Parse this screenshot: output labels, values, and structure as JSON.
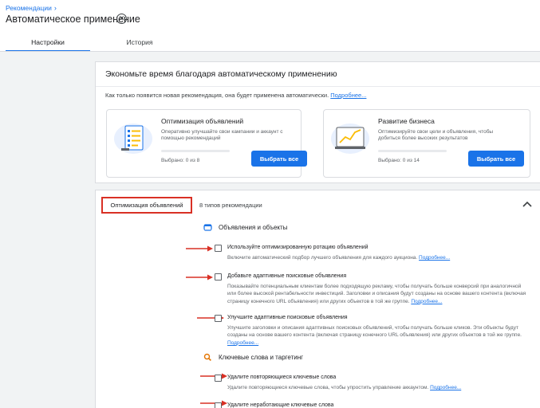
{
  "header": {
    "breadcrumb": "Рекомендации",
    "title": "Автоматическое применение",
    "tabs": [
      {
        "label": "Настройки",
        "active": true
      },
      {
        "label": "История",
        "active": false
      }
    ]
  },
  "savings_card": {
    "title": "Экономьте время благодаря автоматическому применению",
    "description": "Как только появится новая рекомендация, она будет применена автоматически.",
    "more_link": "Подробнее...",
    "cards": [
      {
        "title": "Оптимизация объявлений",
        "description": "Оперативно улучшайте свои кампании и аккаунт с помощью рекомендаций",
        "progress": 0,
        "selected_text": "Выбрано: 0 из 8",
        "button": "Выбрать все"
      },
      {
        "title": "Развитие бизнеса",
        "description": "Оптимизируйте свои цели и объявления, чтобы добиться более высоких результатов",
        "progress": 0,
        "selected_text": "Выбрано: 0 из 14",
        "button": "Выбрать все"
      }
    ]
  },
  "optimization_section": {
    "label": "Оптимизация объявлений",
    "count": "8 типов рекомендации",
    "groups": [
      {
        "title": "Объявления и объекты",
        "icon": "ads-icon",
        "color": "#1a73e8"
      },
      {
        "title": "Ключевые слова и таргетинг",
        "icon": "search-icon",
        "color": "#e37400"
      }
    ],
    "items": [
      {
        "title": "Используйте оптимизированную ротацию объявлений",
        "description": "Включите автоматический подбор лучшего объявления для каждого аукциона.",
        "more_link": "Подробнее..."
      },
      {
        "title": "Добавьте адаптивные поисковые объявления",
        "description": "Показывайте потенциальным клиентам более подходящую рекламу, чтобы получать больше конверсий при аналогичной или более высокой рентабельности инвестиций. Заголовки и описания будут созданы на основе вашего контента (включая страницу конечного URL объявления) или других объектов в той же группе.",
        "more_link": "Подробнее..."
      },
      {
        "title": "Улучшите адаптивные поисковые объявления",
        "description": "Улучшите заголовки и описания адаптивных поисковых объявлений, чтобы получать больше кликов. Эти объекты будут созданы на основе вашего контента (включая страницу конечного URL объявления) или других объектов в той же группе.",
        "more_link": "Подробнее..."
      },
      {
        "title": "Удалите повторяющиеся ключевые слова",
        "description": "Удалите повторяющиеся ключевые слова, чтобы упростить управление аккаунтом.",
        "more_link": "Подробнее..."
      },
      {
        "title": "Удалите неработающие ключевые слова",
        "description": "",
        "more_link": ""
      }
    ]
  },
  "colors": {
    "accent": "#1a73e8",
    "highlight": "#d93025",
    "arrow": "#d93025"
  }
}
